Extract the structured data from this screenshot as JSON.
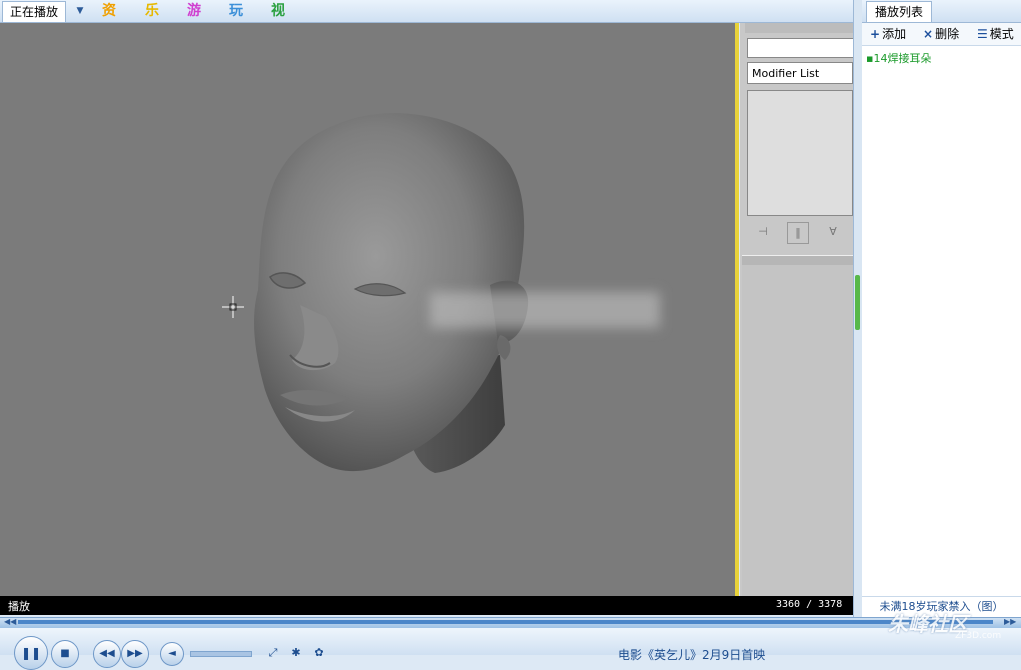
{
  "top_tabs": {
    "now_playing": "正在播放",
    "categories": [
      {
        "label": "资",
        "color": "#f0a000"
      },
      {
        "label": "乐",
        "color": "#e6b800"
      },
      {
        "label": "游",
        "color": "#d040d0"
      },
      {
        "label": "玩",
        "color": "#3b8fd8"
      },
      {
        "label": "视",
        "color": "#2aa040"
      }
    ]
  },
  "command_panel": {
    "modifier_list": "Modifier List"
  },
  "playlist": {
    "tab_label": "播放列表",
    "add_label": "添加",
    "delete_label": "删除",
    "mode_label": "模式",
    "items": [
      "14焊接耳朵"
    ],
    "footer": "未满18岁玩家禁入（图）"
  },
  "status": {
    "state": "播放",
    "time": "3360 / 3378"
  },
  "progress": {
    "position": 3360,
    "duration": 3378
  },
  "ticker": "电影《英乞儿》2月9日首映",
  "watermark": {
    "main": "朱峰社区",
    "sub": "ZF3D.com"
  },
  "icons": {
    "tab_menu": "chevron-down-icon",
    "add": "plus-icon",
    "delete": "x-icon",
    "mode": "list-icon",
    "pause": "pause-icon",
    "stop": "stop-icon",
    "prev": "previous-icon",
    "next": "next-icon",
    "volume": "speaker-icon",
    "fullscreen": "fullscreen-icon",
    "settings": "gear-icon",
    "skin": "palette-icon"
  }
}
